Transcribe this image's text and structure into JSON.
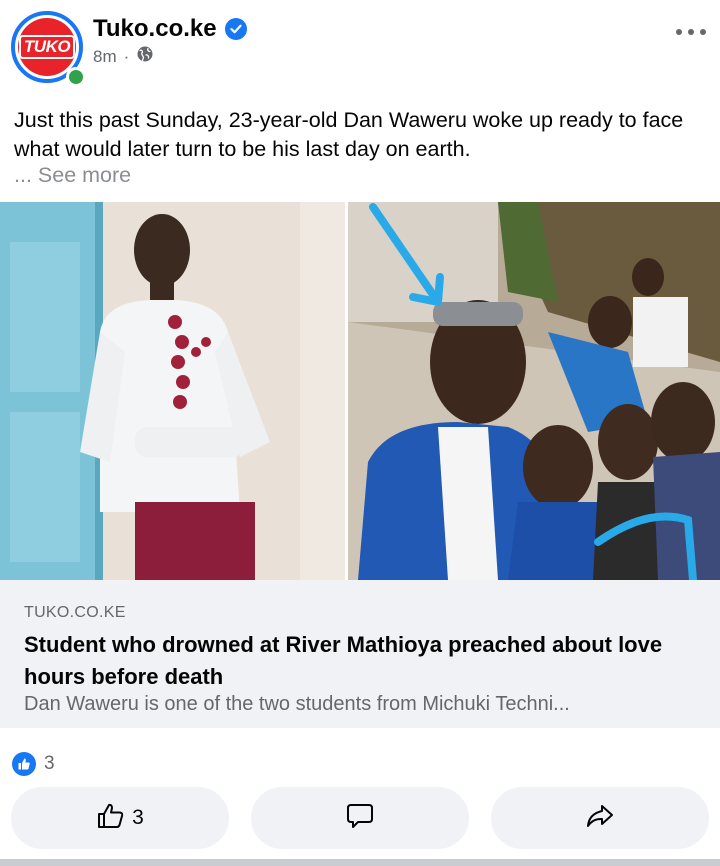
{
  "post": {
    "page_name": "Tuko.co.ke",
    "avatar_text": "TUKO",
    "time": "8m",
    "separator": "·",
    "privacy_icon": "globe-icon",
    "text": "Just this past Sunday, 23-year-old Dan Waweru woke up ready to face what would later turn to be his last day on earth.",
    "see_more": "... See more"
  },
  "link_preview": {
    "domain": "TUKO.CO.KE",
    "title": "Student who drowned at River Mathioya preached about love hours before death",
    "description": "Dan Waweru is one of the two students from Michuki Techni..."
  },
  "reactions": {
    "like_count": "3"
  },
  "actions": {
    "like_count": "3",
    "like_icon": "thumbs-up-icon",
    "comment_icon": "comment-icon",
    "share_icon": "share-icon"
  },
  "colors": {
    "accent": "#1877f2",
    "brand": "#e8232a",
    "online": "#31a24c"
  }
}
